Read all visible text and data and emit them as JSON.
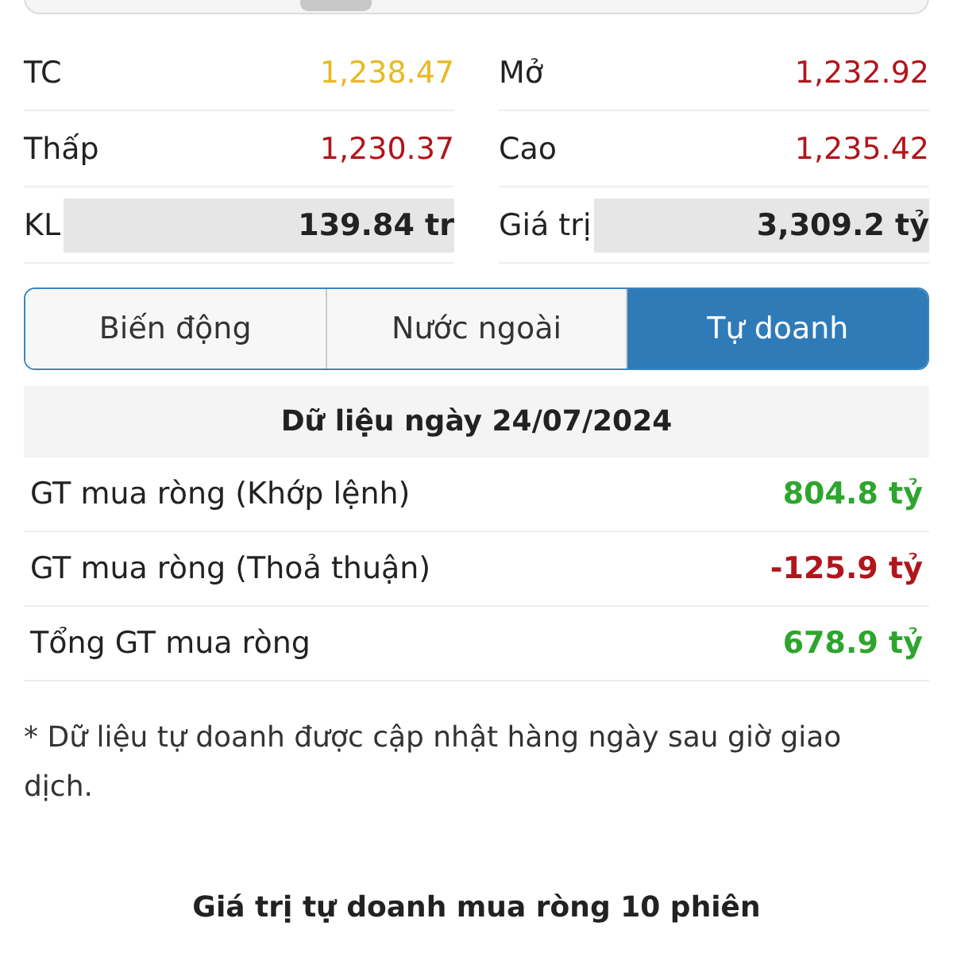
{
  "stats": [
    {
      "label": "TC",
      "value": "1,238.47",
      "color": "#e8b923",
      "shaded": false
    },
    {
      "label": "Mở",
      "value": "1,232.92",
      "color": "#b0161c",
      "shaded": false
    },
    {
      "label": "Thấp",
      "value": "1,230.37",
      "color": "#b0161c",
      "shaded": false
    },
    {
      "label": "Cao",
      "value": "1,235.42",
      "color": "#b0161c",
      "shaded": false
    },
    {
      "label": "KL",
      "value": "139.84 tr",
      "color": "#222222",
      "shaded": true
    },
    {
      "label": "Giá trị",
      "value": "3,309.2 tỷ",
      "color": "#222222",
      "shaded": true
    }
  ],
  "tabs": [
    {
      "label": "Biến động",
      "selected": false
    },
    {
      "label": "Nước ngoài",
      "selected": false
    },
    {
      "label": "Tự doanh",
      "selected": true
    }
  ],
  "date_header": "Dữ liệu ngày 24/07/2024",
  "net_rows": [
    {
      "label": "GT mua ròng (Khớp lệnh)",
      "value": "804.8 tỷ",
      "color": "#2ea52e"
    },
    {
      "label": "GT mua ròng (Thoả thuận)",
      "value": "-125.9 tỷ",
      "color": "#b0161c"
    },
    {
      "label": "Tổng GT mua ròng",
      "value": "678.9 tỷ",
      "color": "#2ea52e"
    }
  ],
  "note": "* Dữ liệu tự doanh được cập nhật hàng ngày sau giờ giao dịch.",
  "chart_title": "Giá trị tự doanh mua ròng 10 phiên"
}
